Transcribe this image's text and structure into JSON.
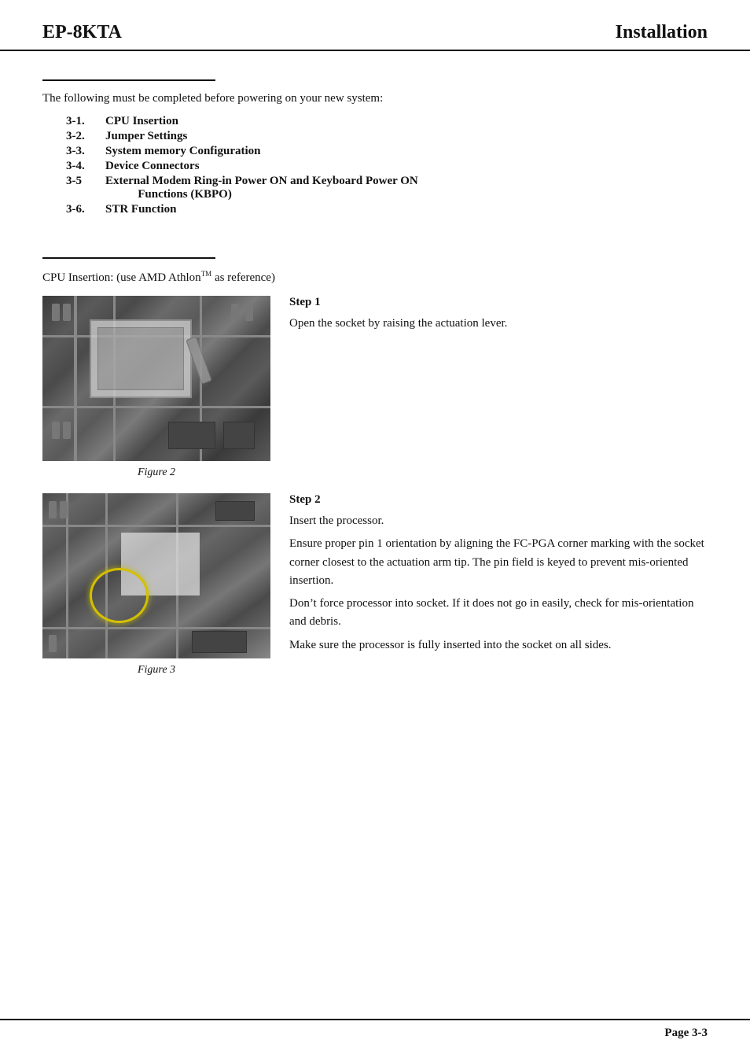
{
  "header": {
    "left": "EP-8KTA",
    "right": "Installation"
  },
  "intro": {
    "text": "The following must be completed before powering on your new system:",
    "toc": [
      {
        "num": "3-1.",
        "label": "CPU Insertion"
      },
      {
        "num": "3-2.",
        "label": "Jumper Settings"
      },
      {
        "num": "3-3.",
        "label": "System memory Configuration"
      },
      {
        "num": "3-4.",
        "label": "Device Connectors"
      },
      {
        "num": "3-5",
        "label": "External Modem Ring-in Power ON and Keyboard Power ON Functions (KBPO)"
      },
      {
        "num": "3-6.",
        "label": "STR Function"
      }
    ]
  },
  "cpu_section": {
    "intro": "CPU Insertion: (use AMD Athlon",
    "tm": "TM",
    "intro_end": " as reference)",
    "step1": {
      "title": "Step 1",
      "text": "Open the socket by raising the actuation lever."
    },
    "fig2_caption": "Figure 2",
    "step2": {
      "title": "Step 2",
      "para1": "Insert the processor.",
      "para2": "Ensure proper pin 1 orientation by aligning the FC-PGA corner marking with the socket corner closest to the actuation arm tip. The pin field is keyed to prevent mis-oriented insertion.",
      "para3": "Don’t force processor into socket. If it does not go in easily, check for mis-orientation and debris.",
      "para4": "Make sure the processor is fully inserted into the socket on all sides."
    },
    "fig3_caption": "Figure 3"
  },
  "footer": {
    "page": "Page 3-3"
  }
}
